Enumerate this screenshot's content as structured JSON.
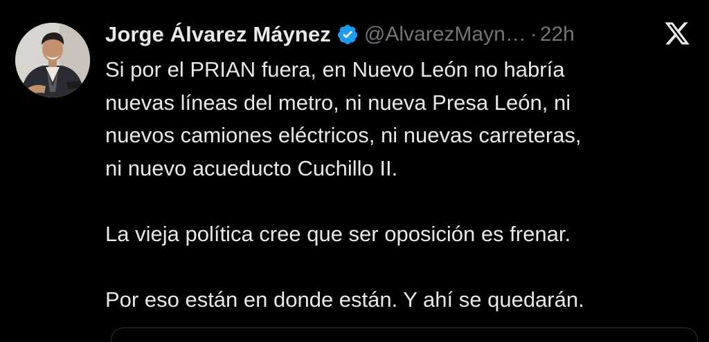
{
  "tweet": {
    "author": {
      "name": "Jorge Álvarez Máynez",
      "handle": "@AlvarezMayn…",
      "separator": "·",
      "time": "22h",
      "verified": true,
      "verified_color": "#1d9bf0"
    },
    "paragraphs": [
      [
        "Si por el PRIAN fuera, en Nuevo León no habría",
        "nuevas líneas del metro, ni nueva Presa León, ni",
        "nuevos camiones eléctricos, ni nuevas carreteras,",
        "ni nuevo acueducto Cuchillo II."
      ],
      [
        "La vieja política cree que ser oposición es frenar."
      ],
      [
        "Por eso están en donde están. Y ahí se quedarán."
      ]
    ]
  },
  "colors": {
    "background": "#000000",
    "text": "#e7e9ea",
    "secondary": "#71767b",
    "border": "#2f3336"
  },
  "icons": {
    "verified": "verified-badge-icon",
    "brand": "x-logo-icon"
  }
}
